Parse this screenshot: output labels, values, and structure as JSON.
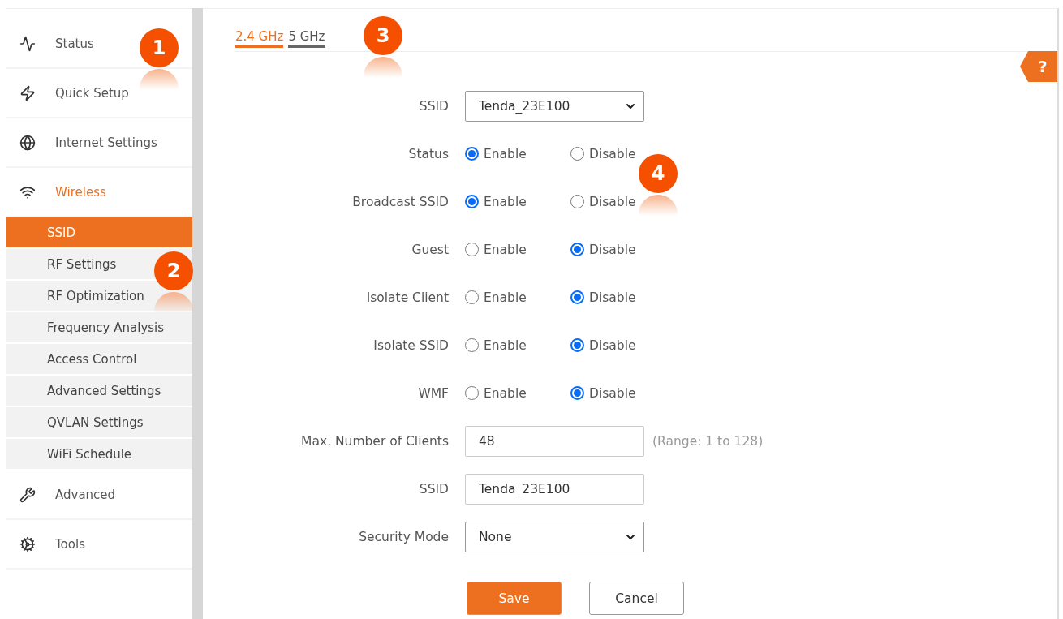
{
  "sidebar": {
    "items": [
      {
        "label": "Status",
        "selected": false
      },
      {
        "label": "Quick Setup",
        "selected": false
      },
      {
        "label": "Internet Settings",
        "selected": false
      },
      {
        "label": "Wireless",
        "selected": true,
        "children": [
          {
            "label": "SSID",
            "selected": true
          },
          {
            "label": "RF Settings",
            "selected": false
          },
          {
            "label": "RF Optimization",
            "selected": false
          },
          {
            "label": "Frequency Analysis",
            "selected": false
          },
          {
            "label": "Access Control",
            "selected": false
          },
          {
            "label": "Advanced Settings",
            "selected": false
          },
          {
            "label": "QVLAN Settings",
            "selected": false
          },
          {
            "label": "WiFi Schedule",
            "selected": false
          }
        ]
      },
      {
        "label": "Advanced",
        "selected": false
      },
      {
        "label": "Tools",
        "selected": false
      }
    ]
  },
  "tabs": [
    {
      "label": "2.4 GHz",
      "selected": true
    },
    {
      "label": "5 GHz",
      "selected": false
    }
  ],
  "help": {
    "label": "?"
  },
  "form": {
    "rows": [
      {
        "kind": "select",
        "label": "SSID",
        "value": "Tenda_23E100"
      },
      {
        "kind": "radio",
        "label": "Status",
        "options": [
          {
            "label": "Enable",
            "selected": true
          },
          {
            "label": "Disable",
            "selected": false
          }
        ]
      },
      {
        "kind": "radio",
        "label": "Broadcast SSID",
        "options": [
          {
            "label": "Enable",
            "selected": true
          },
          {
            "label": "Disable",
            "selected": false
          }
        ]
      },
      {
        "kind": "radio",
        "label": "Guest",
        "options": [
          {
            "label": "Enable",
            "selected": false
          },
          {
            "label": "Disable",
            "selected": true
          }
        ]
      },
      {
        "kind": "radio",
        "label": "Isolate Client",
        "options": [
          {
            "label": "Enable",
            "selected": false
          },
          {
            "label": "Disable",
            "selected": true
          }
        ]
      },
      {
        "kind": "radio",
        "label": "Isolate SSID",
        "options": [
          {
            "label": "Enable",
            "selected": false
          },
          {
            "label": "Disable",
            "selected": true
          }
        ]
      },
      {
        "kind": "radio",
        "label": "WMF",
        "options": [
          {
            "label": "Enable",
            "selected": false
          },
          {
            "label": "Disable",
            "selected": true
          }
        ]
      },
      {
        "kind": "text",
        "label": "Max. Number of Clients",
        "value": "48",
        "hint": "(Range: 1 to 128)"
      },
      {
        "kind": "text",
        "label": "SSID",
        "value": "Tenda_23E100"
      },
      {
        "kind": "select",
        "label": "Security Mode",
        "value": "None"
      }
    ],
    "buttons": [
      {
        "label": "Save",
        "kind": "primary"
      },
      {
        "label": "Cancel",
        "kind": "secondary"
      }
    ]
  },
  "callouts": [
    "1",
    "2",
    "3",
    "4"
  ]
}
